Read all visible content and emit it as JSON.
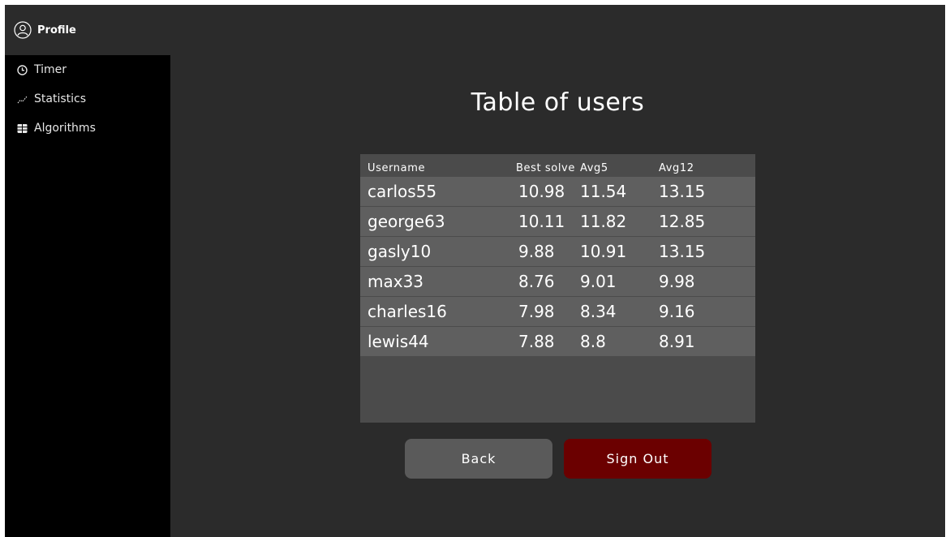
{
  "profile": {
    "label": "Profile",
    "icon": "user-circle-icon"
  },
  "nav": {
    "items": [
      {
        "label": "Timer",
        "icon": "clock-icon"
      },
      {
        "label": "Statistics",
        "icon": "chart-line-icon"
      },
      {
        "label": "Algorithms",
        "icon": "grid-icon"
      }
    ]
  },
  "main": {
    "title": "Table of users",
    "table": {
      "columns": [
        "Username",
        "Best solve",
        "Avg5",
        "Avg12"
      ],
      "rows": [
        [
          "carlos55",
          "10.98",
          "11.54",
          "13.15"
        ],
        [
          "george63",
          "10.11",
          "11.82",
          "12.85"
        ],
        [
          "gasly10",
          "9.88",
          "10.91",
          "13.15"
        ],
        [
          "max33",
          "8.76",
          "9.01",
          "9.98"
        ],
        [
          "charles16",
          "7.98",
          "8.34",
          "9.16"
        ],
        [
          "lewis44",
          "7.88",
          "8.8",
          "8.91"
        ]
      ]
    },
    "buttons": {
      "back": "Back",
      "sign_out": "Sign Out"
    }
  },
  "colors": {
    "background": "#2b2b2b",
    "sidebar": "#000000",
    "table_panel": "#4b4b4b",
    "table_row": "#5f5f5f",
    "back_button": "#5a5a5a",
    "sign_out_button": "#6b0000"
  }
}
